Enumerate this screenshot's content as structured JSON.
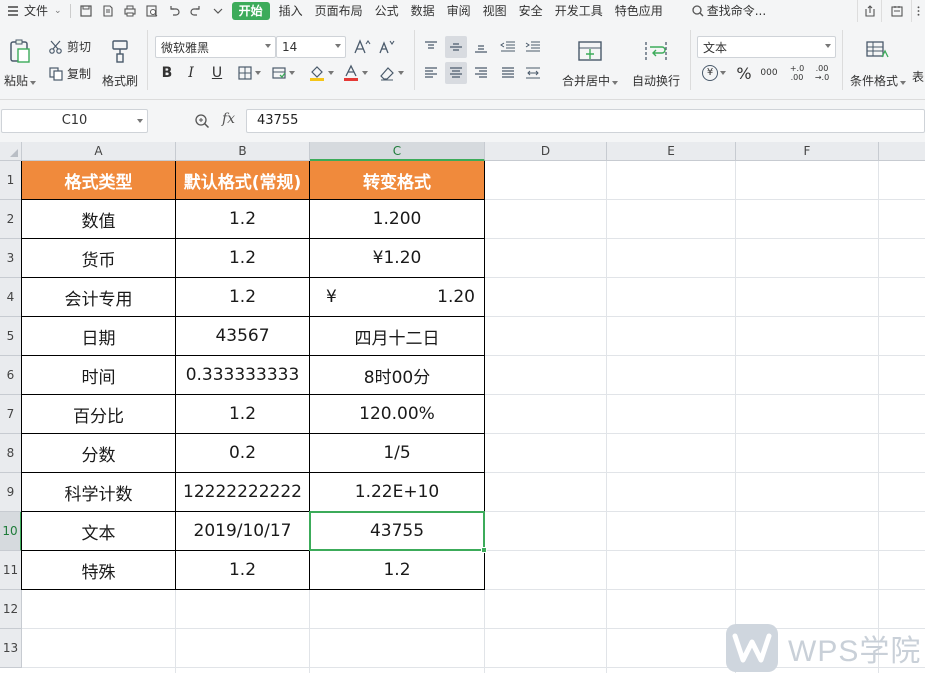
{
  "menubar": {
    "file_label": "文件",
    "tabs": [
      "开始",
      "插入",
      "页面布局",
      "公式",
      "数据",
      "审阅",
      "视图",
      "安全",
      "开发工具",
      "特色应用"
    ],
    "active_tab": "开始",
    "search_label": "查找命令..."
  },
  "ribbon": {
    "paste": "粘贴",
    "cut": "剪切",
    "copy": "复制",
    "format_painter": "格式刷",
    "font_name": "微软雅黑",
    "font_size": "14",
    "merge_center": "合并居中",
    "wrap_text": "自动换行",
    "number_format": "文本",
    "conditional_format": "条件格式",
    "table_style_partial": "表",
    "bold": "B",
    "italic": "I",
    "underline": "U",
    "currency_symbol": "¥",
    "percent_symbol": "%",
    "thousands_symbol": "000",
    "inc_decimal_top": "+.0",
    "inc_decimal_bottom": ".00",
    "dec_decimal_top": ".00",
    "dec_decimal_bottom": "→.0"
  },
  "formula_bar": {
    "cell_ref": "C10",
    "fx": "fx",
    "value": "43755"
  },
  "sheet": {
    "columns": [
      "A",
      "B",
      "C",
      "D",
      "E",
      "F"
    ],
    "rows": [
      "1",
      "2",
      "3",
      "4",
      "5",
      "6",
      "7",
      "8",
      "9",
      "10",
      "11",
      "12",
      "13"
    ],
    "selected_cell": "C10",
    "header": [
      "格式类型",
      "默认格式(常规)",
      "转变格式"
    ],
    "data": [
      [
        "数值",
        "1.2",
        "1.200"
      ],
      [
        "货币",
        "1.2",
        "¥1.20"
      ],
      [
        "会计专用",
        "1.2",
        "1.20"
      ],
      [
        "日期",
        "43567",
        "四月十二日"
      ],
      [
        "时间",
        "0.333333333",
        "8时00分"
      ],
      [
        "百分比",
        "1.2",
        "120.00%"
      ],
      [
        "分数",
        "0.2",
        "1/5"
      ],
      [
        "科学计数",
        "12222222222",
        "1.22E+10"
      ],
      [
        "文本",
        "2019/10/17",
        "43755"
      ],
      [
        "特殊",
        "1.2",
        "1.2"
      ]
    ],
    "accounting_symbol": "¥"
  },
  "watermark": {
    "text": "WPS学院"
  },
  "colors": {
    "accent_green": "#3cab5a",
    "header_orange": "#f08a3c",
    "grid_line": "#e1e4e8"
  }
}
